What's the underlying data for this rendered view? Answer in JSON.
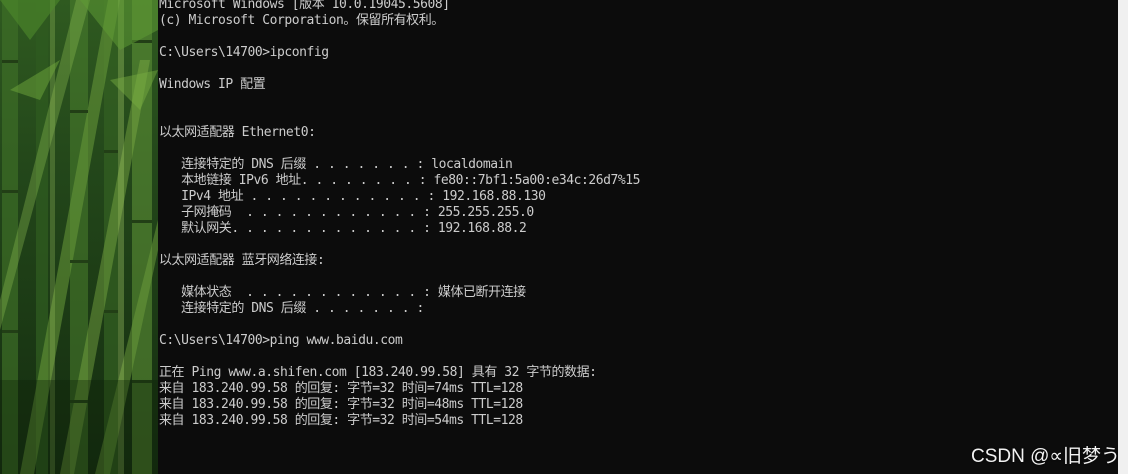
{
  "terminal": {
    "lines": [
      "Microsoft Windows [版本 10.0.19045.5608]",
      "(c) Microsoft Corporation。保留所有权利。",
      "",
      "C:\\Users\\14700>ipconfig",
      "",
      "Windows IP 配置",
      "",
      "",
      "以太网适配器 Ethernet0:",
      "",
      "   连接特定的 DNS 后缀 . . . . . . . : localdomain",
      "   本地链接 IPv6 地址. . . . . . . . : fe80::7bf1:5a00:e34c:26d7%15",
      "   IPv4 地址 . . . . . . . . . . . . : 192.168.88.130",
      "   子网掩码  . . . . . . . . . . . . : 255.255.255.0",
      "   默认网关. . . . . . . . . . . . . : 192.168.88.2",
      "",
      "以太网适配器 蓝牙网络连接:",
      "",
      "   媒体状态  . . . . . . . . . . . . : 媒体已断开连接",
      "   连接特定的 DNS 后缀 . . . . . . . :",
      "",
      "C:\\Users\\14700>ping www.baidu.com",
      "",
      "正在 Ping www.a.shifen.com [183.240.99.58] 具有 32 字节的数据:",
      "来自 183.240.99.58 的回复: 字节=32 时间=74ms TTL=128",
      "来自 183.240.99.58 的回复: 字节=32 时间=48ms TTL=128",
      "来自 183.240.99.58 的回复: 字节=32 时间=54ms TTL=128"
    ]
  },
  "watermark": {
    "text": "CSDN @∝旧梦う"
  },
  "colors": {
    "console_background": "#0c0c0c",
    "console_text": "#cccccc",
    "wallpaper_green": "#2f5a20"
  }
}
